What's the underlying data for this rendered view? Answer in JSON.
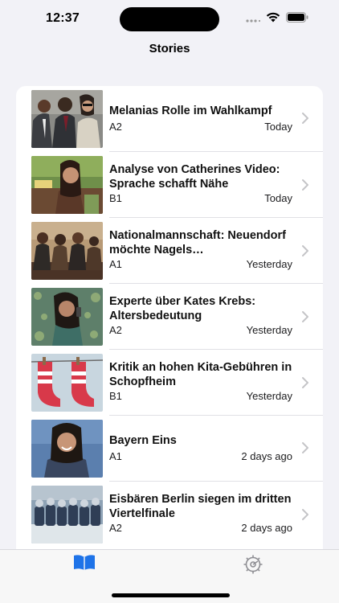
{
  "status": {
    "time": "12:37"
  },
  "nav": {
    "title": "Stories"
  },
  "stories": [
    {
      "title": "Melanias Rolle im Wahlkampf",
      "level": "A2",
      "date": "Today",
      "thumb": "people-in-suits"
    },
    {
      "title": "Analyse von Catherines Video: Sprache schafft Nähe",
      "level": "B1",
      "date": "Today",
      "thumb": "woman-on-bench"
    },
    {
      "title": "Nationalmannschaft: Neuendorf möchte Nagels…",
      "level": "A1",
      "date": "Yesterday",
      "thumb": "men-seated"
    },
    {
      "title": "Experte über Kates Krebs: Altersbedeutung",
      "level": "A2",
      "date": "Yesterday",
      "thumb": "woman-with-phone"
    },
    {
      "title": "Kritik an hohen Kita-Gebühren in Schopfheim",
      "level": "B1",
      "date": "Yesterday",
      "thumb": "socks-on-line"
    },
    {
      "title": "Bayern Eins",
      "level": "A1",
      "date": "2 days ago",
      "thumb": "smiling-woman"
    },
    {
      "title": "Eisbären Berlin siegen im dritten Viertelfinale",
      "level": "A2",
      "date": "2 days ago",
      "thumb": "hockey-bench"
    }
  ],
  "tabs": [
    {
      "name": "stories",
      "icon": "book-icon",
      "selected": true
    },
    {
      "name": "settings",
      "icon": "gear-icon",
      "selected": false
    }
  ],
  "colors": {
    "accent": "#1e73e8",
    "inactive": "#8e8e93",
    "background": "#f2f2f7"
  }
}
